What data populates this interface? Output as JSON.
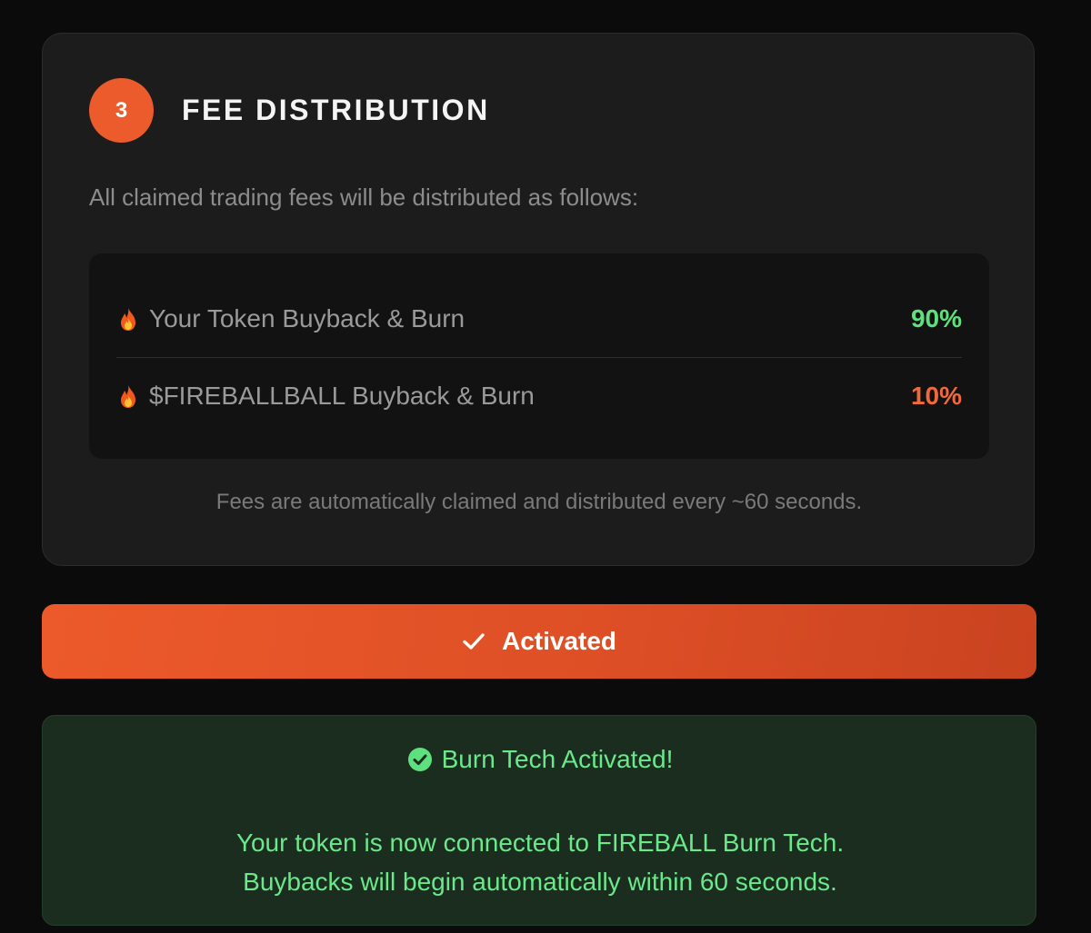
{
  "fee_card": {
    "step_number": "3",
    "title": "FEE DISTRIBUTION",
    "intro": "All claimed trading fees will be distributed as follows:",
    "rows": [
      {
        "icon": "fire-icon",
        "label": "Your Token Buyback & Burn",
        "percent": "90%",
        "color": "#5fe07e"
      },
      {
        "icon": "fire-icon",
        "label": "$FIREBALLBALL Buyback & Burn",
        "percent": "10%",
        "color": "#ee6a3c"
      }
    ],
    "footnote": "Fees are automatically claimed and distributed every ~60 seconds."
  },
  "activate_button": {
    "icon": "check-icon",
    "label": "Activated",
    "color": "#ec5a2b"
  },
  "success": {
    "icon": "check-circle-icon",
    "title": "Burn Tech Activated!",
    "line1": "Your token is now connected to FIREBALL Burn Tech.",
    "line2": "Buybacks will begin automatically within 60 seconds.",
    "color": "#6ae88a"
  }
}
